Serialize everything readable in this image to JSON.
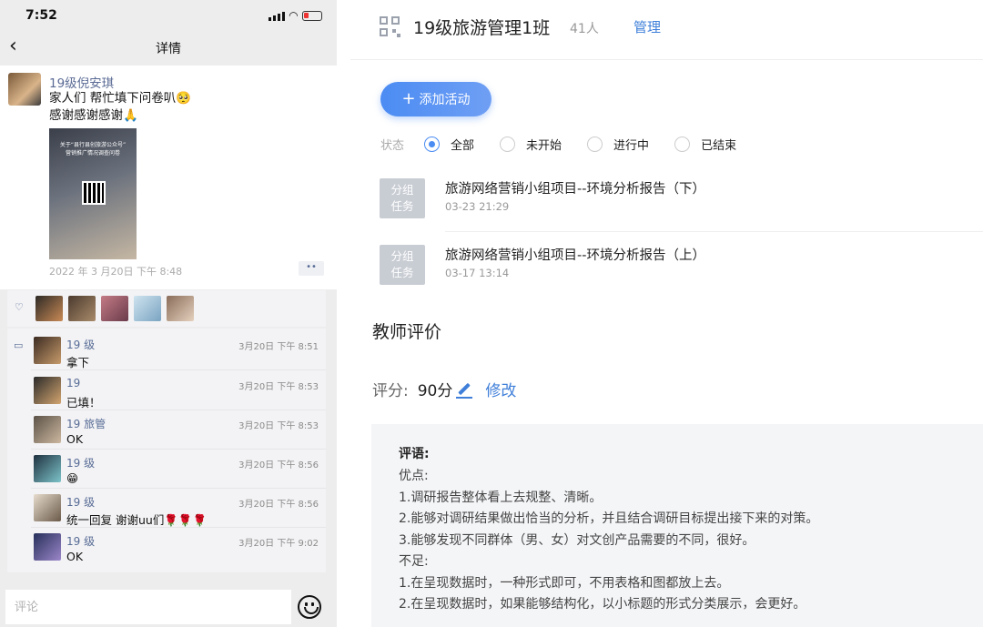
{
  "status_bar": {
    "time": "7:52"
  },
  "phone": {
    "nav_title": "详情",
    "back_icon": "‹",
    "moment": {
      "author": "19级倪安琪",
      "text_lines": [
        "家人们 帮忙填下问卷叭🥺",
        "感谢感谢感谢🙏"
      ],
      "image_caption": [
        "关于“县行县创旅游公众号”",
        "营销推广情况调查问卷"
      ],
      "timestamp": "2022 年 3 月20日 下午 8:48",
      "more_label": "••"
    },
    "comments": [
      {
        "name": "19 级",
        "text": "拿下",
        "time": "3月20日 下午 8:51"
      },
      {
        "name": "19",
        "text": "已填！",
        "time": "3月20日 下午 8:53"
      },
      {
        "name": "19 旅管",
        "text": "OK",
        "time": "3月20日 下午 8:53"
      },
      {
        "name": "19 级",
        "text": "😁",
        "time": "3月20日 下午 8:56"
      },
      {
        "name": "19 级",
        "text": "统一回复 谢谢uu们🌹🌹🌹",
        "time": "3月20日 下午 8:56"
      },
      {
        "name": "19 级",
        "text": "OK",
        "time": "3月20日 下午 9:02"
      }
    ],
    "input_placeholder": "评论"
  },
  "class_panel": {
    "title": "19级旅游管理1班",
    "count": "41人",
    "manage_label": "管理",
    "add_button_label": "添加活动",
    "filter": {
      "label": "状态",
      "options": [
        "全部",
        "未开始",
        "进行中",
        "已结束"
      ],
      "selected": "全部"
    },
    "tasks": [
      {
        "badge_line1": "分组",
        "badge_line2": "任务",
        "title": "旅游网络营销小组项目--环境分析报告（下）",
        "date": "03-23 21:29"
      },
      {
        "badge_line1": "分组",
        "badge_line2": "任务",
        "title": "旅游网络营销小组项目--环境分析报告（上）",
        "date": "03-17 13:14"
      }
    ],
    "evaluation": {
      "title": "教师评价",
      "score_label": "评分:",
      "score_value": "90分",
      "edit_label": "修改",
      "comment_heading": "评语:",
      "comment_lines": [
        "优点:",
        "1.调研报告整体看上去规整、清晰。",
        "2.能够对调研结果做出恰当的分析，并且结合调研目标提出接下来的对策。",
        "3.能够发现不同群体（男、女）对文创产品需要的不同，很好。",
        "不足:",
        "1.在呈现数据时，一种形式即可，不用表格和图都放上去。",
        "2.在呈现数据时，如果能够结构化，以小标题的形式分类展示，会更好。"
      ]
    }
  },
  "colors": {
    "accent": "#4b8cf3",
    "link": "#3f7fd9",
    "wechat_name": "#576b95"
  },
  "icons": [
    "back-chevron-icon",
    "signal-icon",
    "wifi-icon",
    "battery-icon",
    "heart-icon",
    "comment-icon",
    "emoji-icon",
    "qr-code-icon",
    "pencil-icon",
    "plus-icon"
  ]
}
